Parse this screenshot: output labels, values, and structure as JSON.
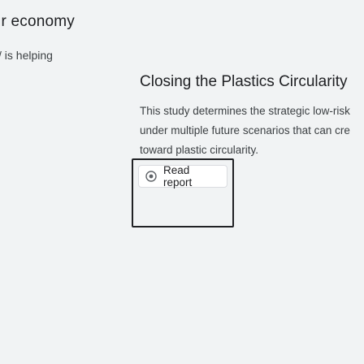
{
  "left": {
    "heading": "ır economy",
    "subtext": "/ is helping"
  },
  "card": {
    "title": "Closing the Plastics Circularity",
    "description_lines": [
      "This study determines the strategic low-risk",
      "under multiple future scenarios that can cre",
      "toward plastic circularity."
    ],
    "button_label": "Read report",
    "button_icon": "visibility-icon"
  }
}
